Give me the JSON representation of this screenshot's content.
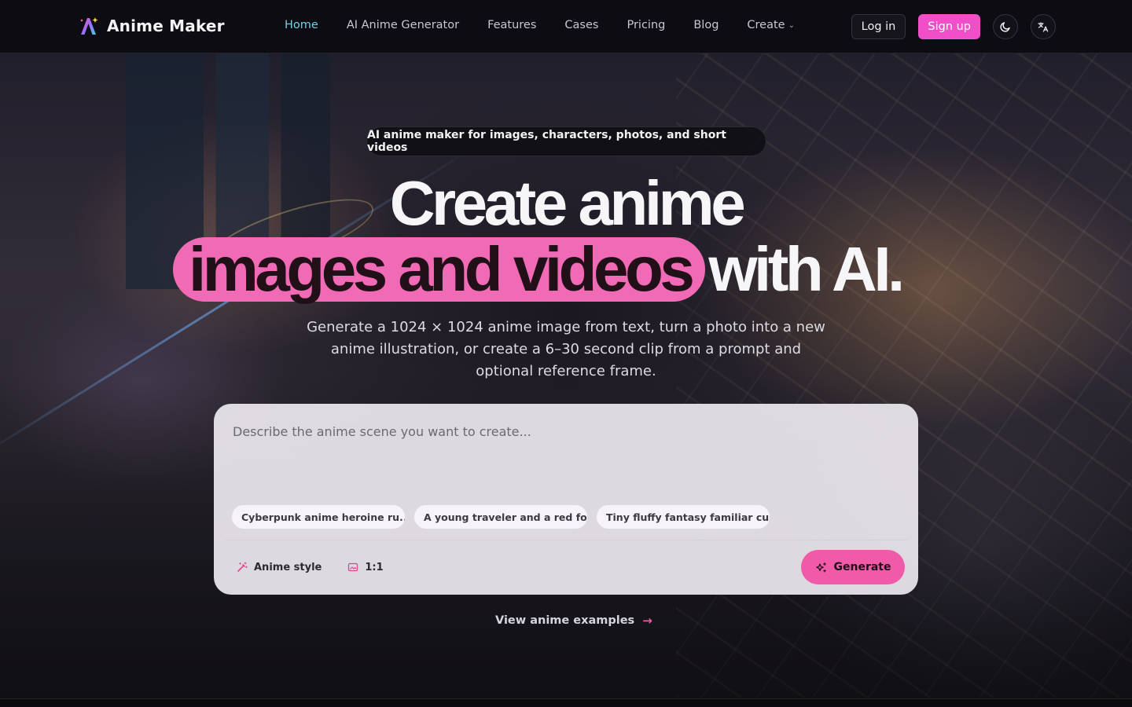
{
  "brand": {
    "name": "Anime Maker",
    "logo_icon": "anime-maker-logo-icon"
  },
  "nav": {
    "items": [
      {
        "label": "Home",
        "active": true
      },
      {
        "label": "AI Anime Generator"
      },
      {
        "label": "Features"
      },
      {
        "label": "Cases"
      },
      {
        "label": "Pricing"
      },
      {
        "label": "Blog"
      },
      {
        "label": "Create",
        "has_dropdown": true
      }
    ]
  },
  "header_actions": {
    "login_label": "Log in",
    "signup_label": "Sign up",
    "theme_icon": "moon-icon",
    "language_icon": "translate-icon"
  },
  "hero": {
    "tagline": "AI anime maker for images, characters, photos, and short videos",
    "title_line1": "Create anime",
    "title_highlight": "images and videos",
    "title_rest": "with AI.",
    "subtitle": "Generate a 1024 × 1024 anime image from text, turn a photo into a new anime illustration, or create a 6–30 second clip from a prompt and optional reference frame."
  },
  "prompt_card": {
    "placeholder": "Describe the anime scene you want to create...",
    "suggestions": [
      "Cyberpunk anime heroine ru...",
      "A young traveler and a red fo...",
      "Tiny fluffy fantasy familiar cu..."
    ],
    "style_option": "Anime style",
    "ratio_option": "1:1",
    "generate_label": "Generate"
  },
  "view_examples_label": "View anime examples",
  "colors": {
    "accent_pink": "#f15aa9",
    "signup_pink": "#f04fc7",
    "highlight_pink": "#f16ab5",
    "nav_active": "#6fd2e6"
  }
}
